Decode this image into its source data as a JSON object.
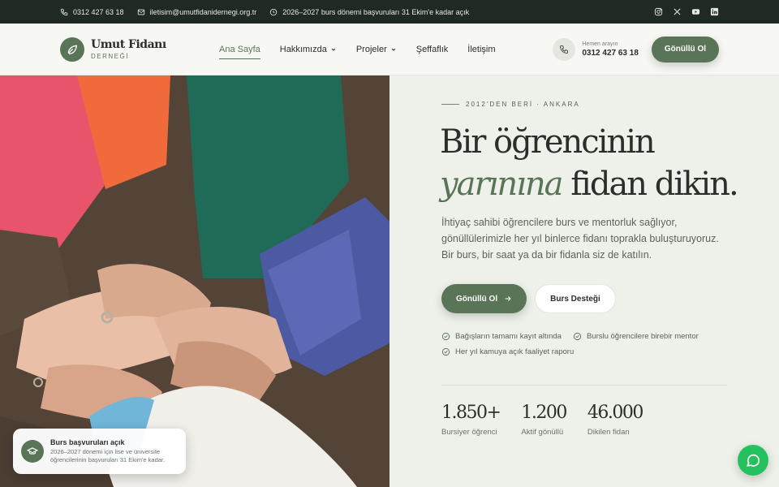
{
  "topbar": {
    "phone": "0312 427 63 18",
    "email": "iletisim@umutfidanidernegi.org.tr",
    "notice": "2026–2027 burs dönemi başvuruları 31 Ekim'e kadar açık",
    "social": [
      "instagram-icon",
      "x-icon",
      "youtube-icon",
      "linkedin-icon"
    ]
  },
  "header": {
    "logo_title": "Umut Fidanı",
    "logo_sub": "DERNEĞİ",
    "nav": [
      {
        "label": "Ana Sayfa",
        "active": true
      },
      {
        "label": "Hakkımızda",
        "dropdown": true
      },
      {
        "label": "Projeler",
        "dropdown": true
      },
      {
        "label": "Şeffaflık"
      },
      {
        "label": "İletişim"
      }
    ],
    "call_label": "Hemen arayın",
    "call_number": "0312 427 63 18",
    "volunteer_button": "Gönüllü Ol"
  },
  "toast": {
    "title": "Burs başvuruları açık",
    "text": "2026–2027 dönemi için lise ve üniversite öğrencilerinin başvuruları 31 Ekim'e kadar."
  },
  "hero": {
    "eyebrow": "2012'DEN BERİ · ANKARA",
    "title_line1": "Bir öğrencinin",
    "title_em": "yarınına",
    "title_rest": " fidan dikin.",
    "lead": "İhtiyaç sahibi öğrencilere burs ve mentorluk sağlıyor, gönüllülerimizle her yıl binlerce fidanı toprakla buluşturuyoruz. Bir burs, bir saat ya da bir fidanla siz de katılın.",
    "primary_button": "Gönüllü Ol",
    "secondary_button": "Burs Desteği",
    "checks": [
      "Bağışların tamamı kayıt altında",
      "Burslu öğrencilere birebir mentor",
      "Her yıl kamuya açık faaliyet raporu"
    ],
    "stats": [
      {
        "value": "1.850+",
        "label": "Bursiyer öğrenci"
      },
      {
        "value": "1.200",
        "label": "Aktif gönüllü"
      },
      {
        "value": "46.000",
        "label": "Dikilen fidan"
      }
    ]
  },
  "colors": {
    "accent": "#5a7457",
    "topbar": "#1f2a22",
    "whatsapp": "#25c15e"
  }
}
